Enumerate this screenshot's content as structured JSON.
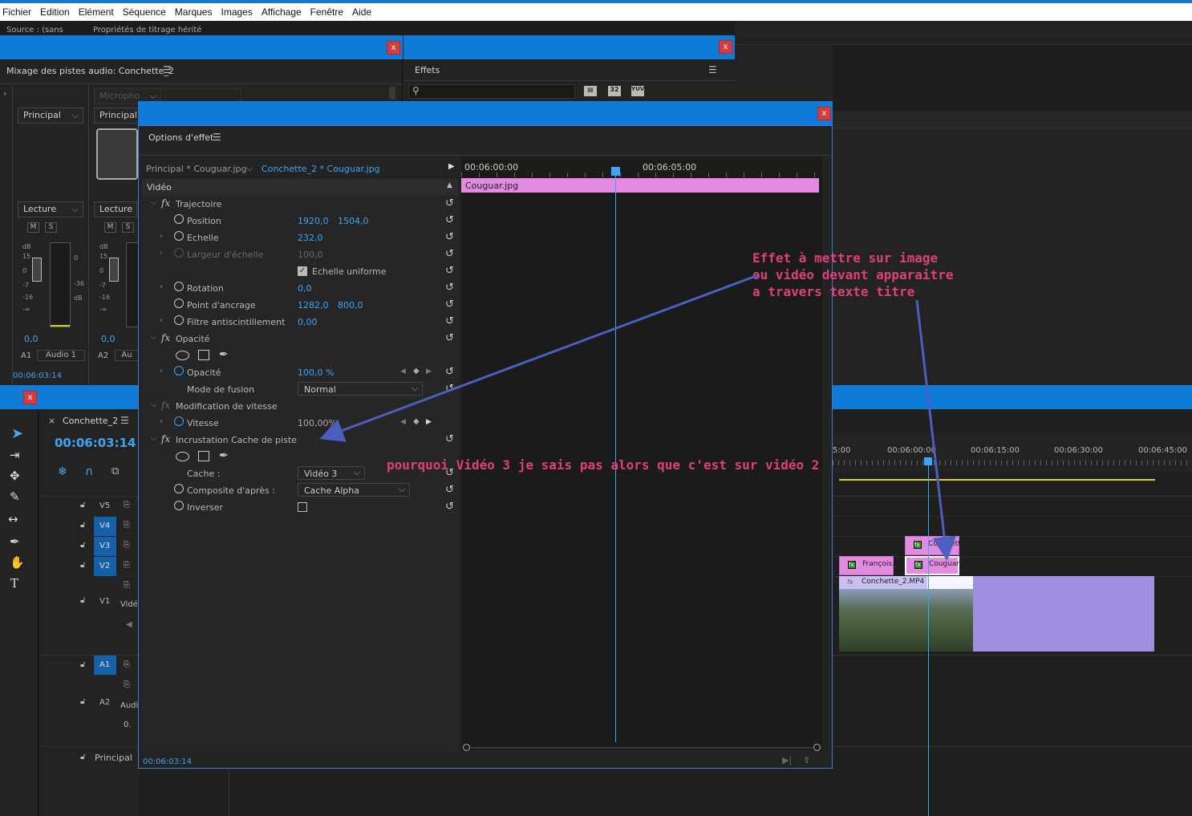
{
  "menu": [
    "Fichier",
    "Edition",
    "Elément",
    "Séquence",
    "Marques",
    "Images",
    "Affichage",
    "Fenêtre",
    "Aide"
  ],
  "source_tabs": {
    "source": "Source : (sans",
    "titrage": "Propriétés de titrage hérité"
  },
  "audio_mixer": {
    "title": "Mixage des pistes audio: Conchette_2",
    "col1": {
      "output": "Principal",
      "mode": "Lecture",
      "m": "M",
      "s": "S",
      "db_val": "0,0",
      "track": "A1",
      "name": "Audio 1"
    },
    "col2": {
      "input": "Micropho",
      "output": "Principal",
      "mode": "Lecture",
      "m": "M",
      "s": "S",
      "db_val": "0,0",
      "track": "A2",
      "name": "Au"
    },
    "scale": [
      "dB",
      "15",
      "0",
      "-7",
      "-16",
      "-∞"
    ],
    "scale_right": [
      "0",
      "-36",
      "dB"
    ],
    "timecode": "00:06:03:14"
  },
  "effects": {
    "title": "Effets",
    "buttons": [
      "32",
      "YUV"
    ]
  },
  "effect_options": {
    "title": "Options d'effet",
    "source_clip": "Principal * Couguar.jpg",
    "seq_clip": "Conchette_2 * Couguar.jpg",
    "section": "Vidéo",
    "tc_start": "00:06:00:00",
    "tc_mid": "00:06:05:00",
    "clip_bar": "Couguar.jpg",
    "rows": {
      "trajectoire": "Trajectoire",
      "position": {
        "label": "Position",
        "x": "1920,0",
        "y": "1504,0"
      },
      "echelle": {
        "label": "Echelle",
        "val": "232,0"
      },
      "largeur": {
        "label": "Largeur d'échelle",
        "val": "100,0"
      },
      "uniforme": {
        "label": "Echelle uniforme"
      },
      "rotation": {
        "label": "Rotation",
        "val": "0,0"
      },
      "ancrage": {
        "label": "Point d'ancrage",
        "x": "1282,0",
        "y": "800,0"
      },
      "filtre": {
        "label": "Filtre antiscintillement",
        "val": "0,00"
      },
      "opacite_fx": "Opacité",
      "opacite": {
        "label": "Opacité",
        "val": "100,0 %"
      },
      "fusion": {
        "label": "Mode de fusion",
        "val": "Normal"
      },
      "vitesse_fx": "Modification de vitesse",
      "vitesse": {
        "label": "Vitesse",
        "val": "100,00%"
      },
      "cache_fx": "Incrustation Cache de piste",
      "cache": {
        "label": "Cache :",
        "val": "Vidéo 3"
      },
      "composite": {
        "label": "Composite d'après :",
        "val": "Cache Alpha"
      },
      "inverser": {
        "label": "Inverser"
      }
    },
    "timecode": "00:06:03:14"
  },
  "timeline": {
    "seq_name": "Conchette_2",
    "timecode": "00:06:03:14",
    "ruler": [
      "5:00",
      "00:06:00:00",
      "00:06:15:00",
      "00:06:30:00",
      "00:06:45:00"
    ],
    "tracks": [
      "V5",
      "V4",
      "V3",
      "V2",
      "V1",
      "A1",
      "A2"
    ],
    "v1_name": "Vidé",
    "a2_name": "Audi",
    "principal": "Principal",
    "principal_val": "0.",
    "clips": {
      "conchett": "Conchett",
      "couguar": "Couguar",
      "francois": "François.",
      "mp4": "Conchette_2.MP4"
    }
  },
  "annotations": {
    "effect_line1": "Effet à mettre sur image",
    "effect_line2": "ou vidéo devant apparaitre",
    "effect_line3": "a travers texte titre",
    "question": "pourquoi Vidéo 3 je sais pas alors que c'est sur vidéo 2"
  },
  "colors": {
    "titlebar": "#0f7ad8",
    "clip_pink": "#e28be0",
    "clip_purple": "#a08fe0",
    "accent": "#3ea5f5",
    "annotation": "#e0407a",
    "arrow": "#4a5fc0"
  }
}
